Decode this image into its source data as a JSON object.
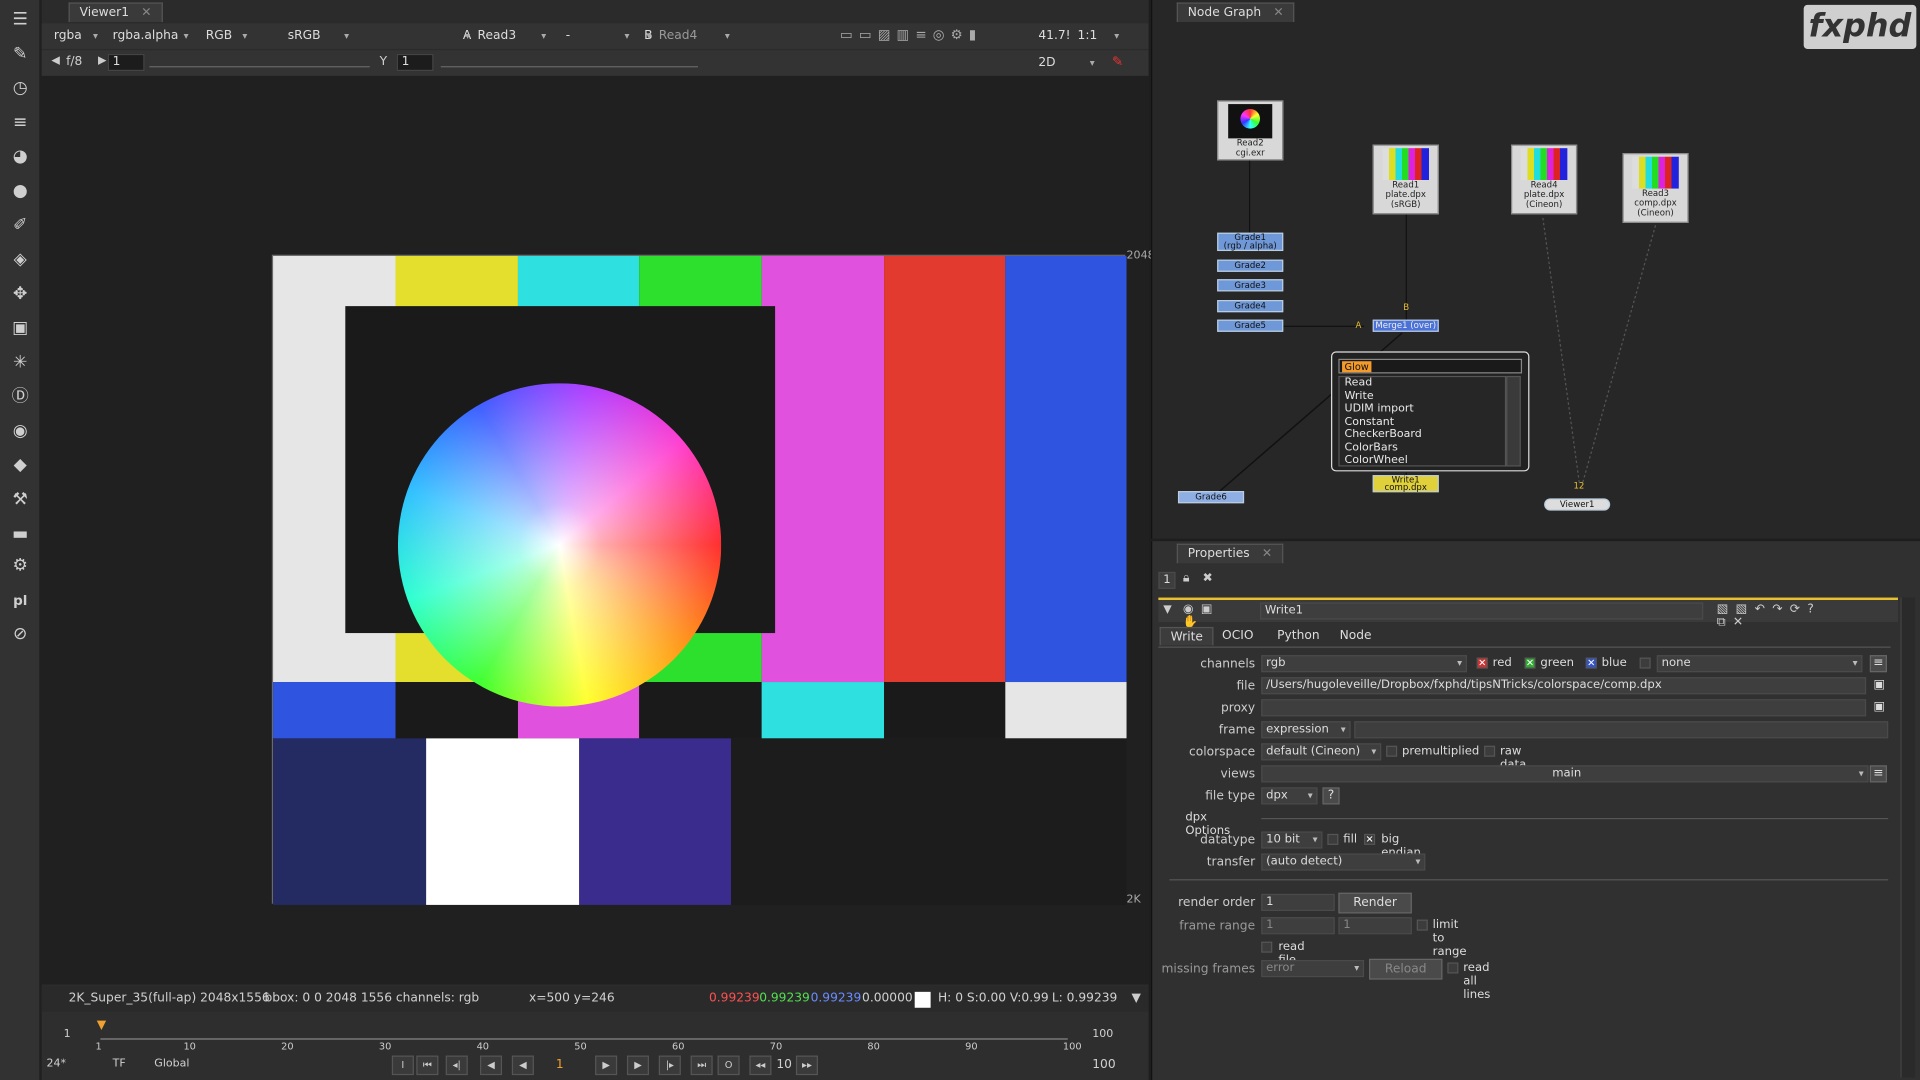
{
  "viewer": {
    "tab": "Viewer1",
    "channels": "rgba",
    "alpha": "rgba.alpha",
    "display": "RGB",
    "lut": "sRGB",
    "inputA_label": "A",
    "inputA": "Read3",
    "dash": "-",
    "inputB_label": "B",
    "inputB": "Read4",
    "zoom": "41.7!",
    "ratio": "1:1",
    "fstop": "f/8",
    "gain": "1",
    "gamma_label": "Y",
    "gamma": "1",
    "mode": "2D",
    "format_top_right": "2048",
    "format_bottom_right": "2K"
  },
  "status": {
    "format": "2K_Super_35(full-ap) 2048x1556",
    "bbox": "bbox: 0 0 2048 1556 channels: rgb",
    "coords": "x=500 y=246",
    "r": "0.99239",
    "g": "0.99239",
    "b": "0.99239",
    "a": "0.00000",
    "hsv": "H:  0 S:0.00 V:0.99",
    "lum": "L: 0.99239"
  },
  "timeline": {
    "start": "1",
    "end": "100",
    "ticks": [
      "1",
      "10",
      "20",
      "30",
      "40",
      "50",
      "60",
      "70",
      "80",
      "90",
      "100"
    ],
    "fps": "24*",
    "tf": "TF",
    "global": "Global",
    "frame": "1",
    "step": "10",
    "end_field": "100"
  },
  "nodegraph": {
    "tab": "Node Graph",
    "logo": "fxphd",
    "read2": "Read2\ncgi.exr",
    "read1": "Read1\nplate.dpx\n(sRGB)",
    "read4": "Read4\nplate.dpx\n(Cineon)",
    "read3": "Read3\ncomp.dpx\n(Cineon)",
    "grades": [
      "Grade1\n(rgb / alpha)",
      "Grade2",
      "Grade3",
      "Grade4",
      "Grade5"
    ],
    "merge": "Merge1 (over)",
    "merge_a": "A",
    "merge_b": "B",
    "grade6": "Grade6",
    "write": "Write1\ncomp.dpx",
    "viewer": "Viewer1",
    "viewer_inputs": "12",
    "popup_text": "Glow",
    "popup_items": [
      "Read",
      "Write",
      "UDIM import",
      "Constant",
      "CheckerBoard",
      "ColorBars",
      "ColorWheel"
    ]
  },
  "properties": {
    "tab": "Properties",
    "count": "1",
    "node_name": "Write1",
    "tabs": [
      "Write",
      "OCIO",
      "Python",
      "Node"
    ],
    "channels_label": "channels",
    "channels": "rgb",
    "red": "red",
    "green": "green",
    "blue": "blue",
    "none": "none",
    "file_label": "file",
    "file": "/Users/hugoleveille/Dropbox/fxphd/tipsNTricks/colorspace/comp.dpx",
    "proxy_label": "proxy",
    "frame_label": "frame",
    "frame": "expression",
    "colorspace_label": "colorspace",
    "colorspace": "default (Cineon)",
    "premultiplied": "premultiplied",
    "raw": "raw data",
    "views_label": "views",
    "views": "main",
    "filetype_label": "file type",
    "filetype": "dpx",
    "help": "?",
    "dpx_options": "dpx Options",
    "datatype_label": "datatype",
    "datatype": "10 bit",
    "fill": "fill",
    "big_endian": "big endian",
    "transfer_label": "transfer",
    "transfer": "(auto detect)",
    "render_order_label": "render order",
    "render_order": "1",
    "render_btn": "Render",
    "frame_range_label": "frame range",
    "range_a": "1",
    "range_b": "1",
    "limit": "limit to range",
    "read_file": "read file",
    "missing_label": "missing frames",
    "missing": "error",
    "reload": "Reload",
    "read_all": "read all lines"
  }
}
